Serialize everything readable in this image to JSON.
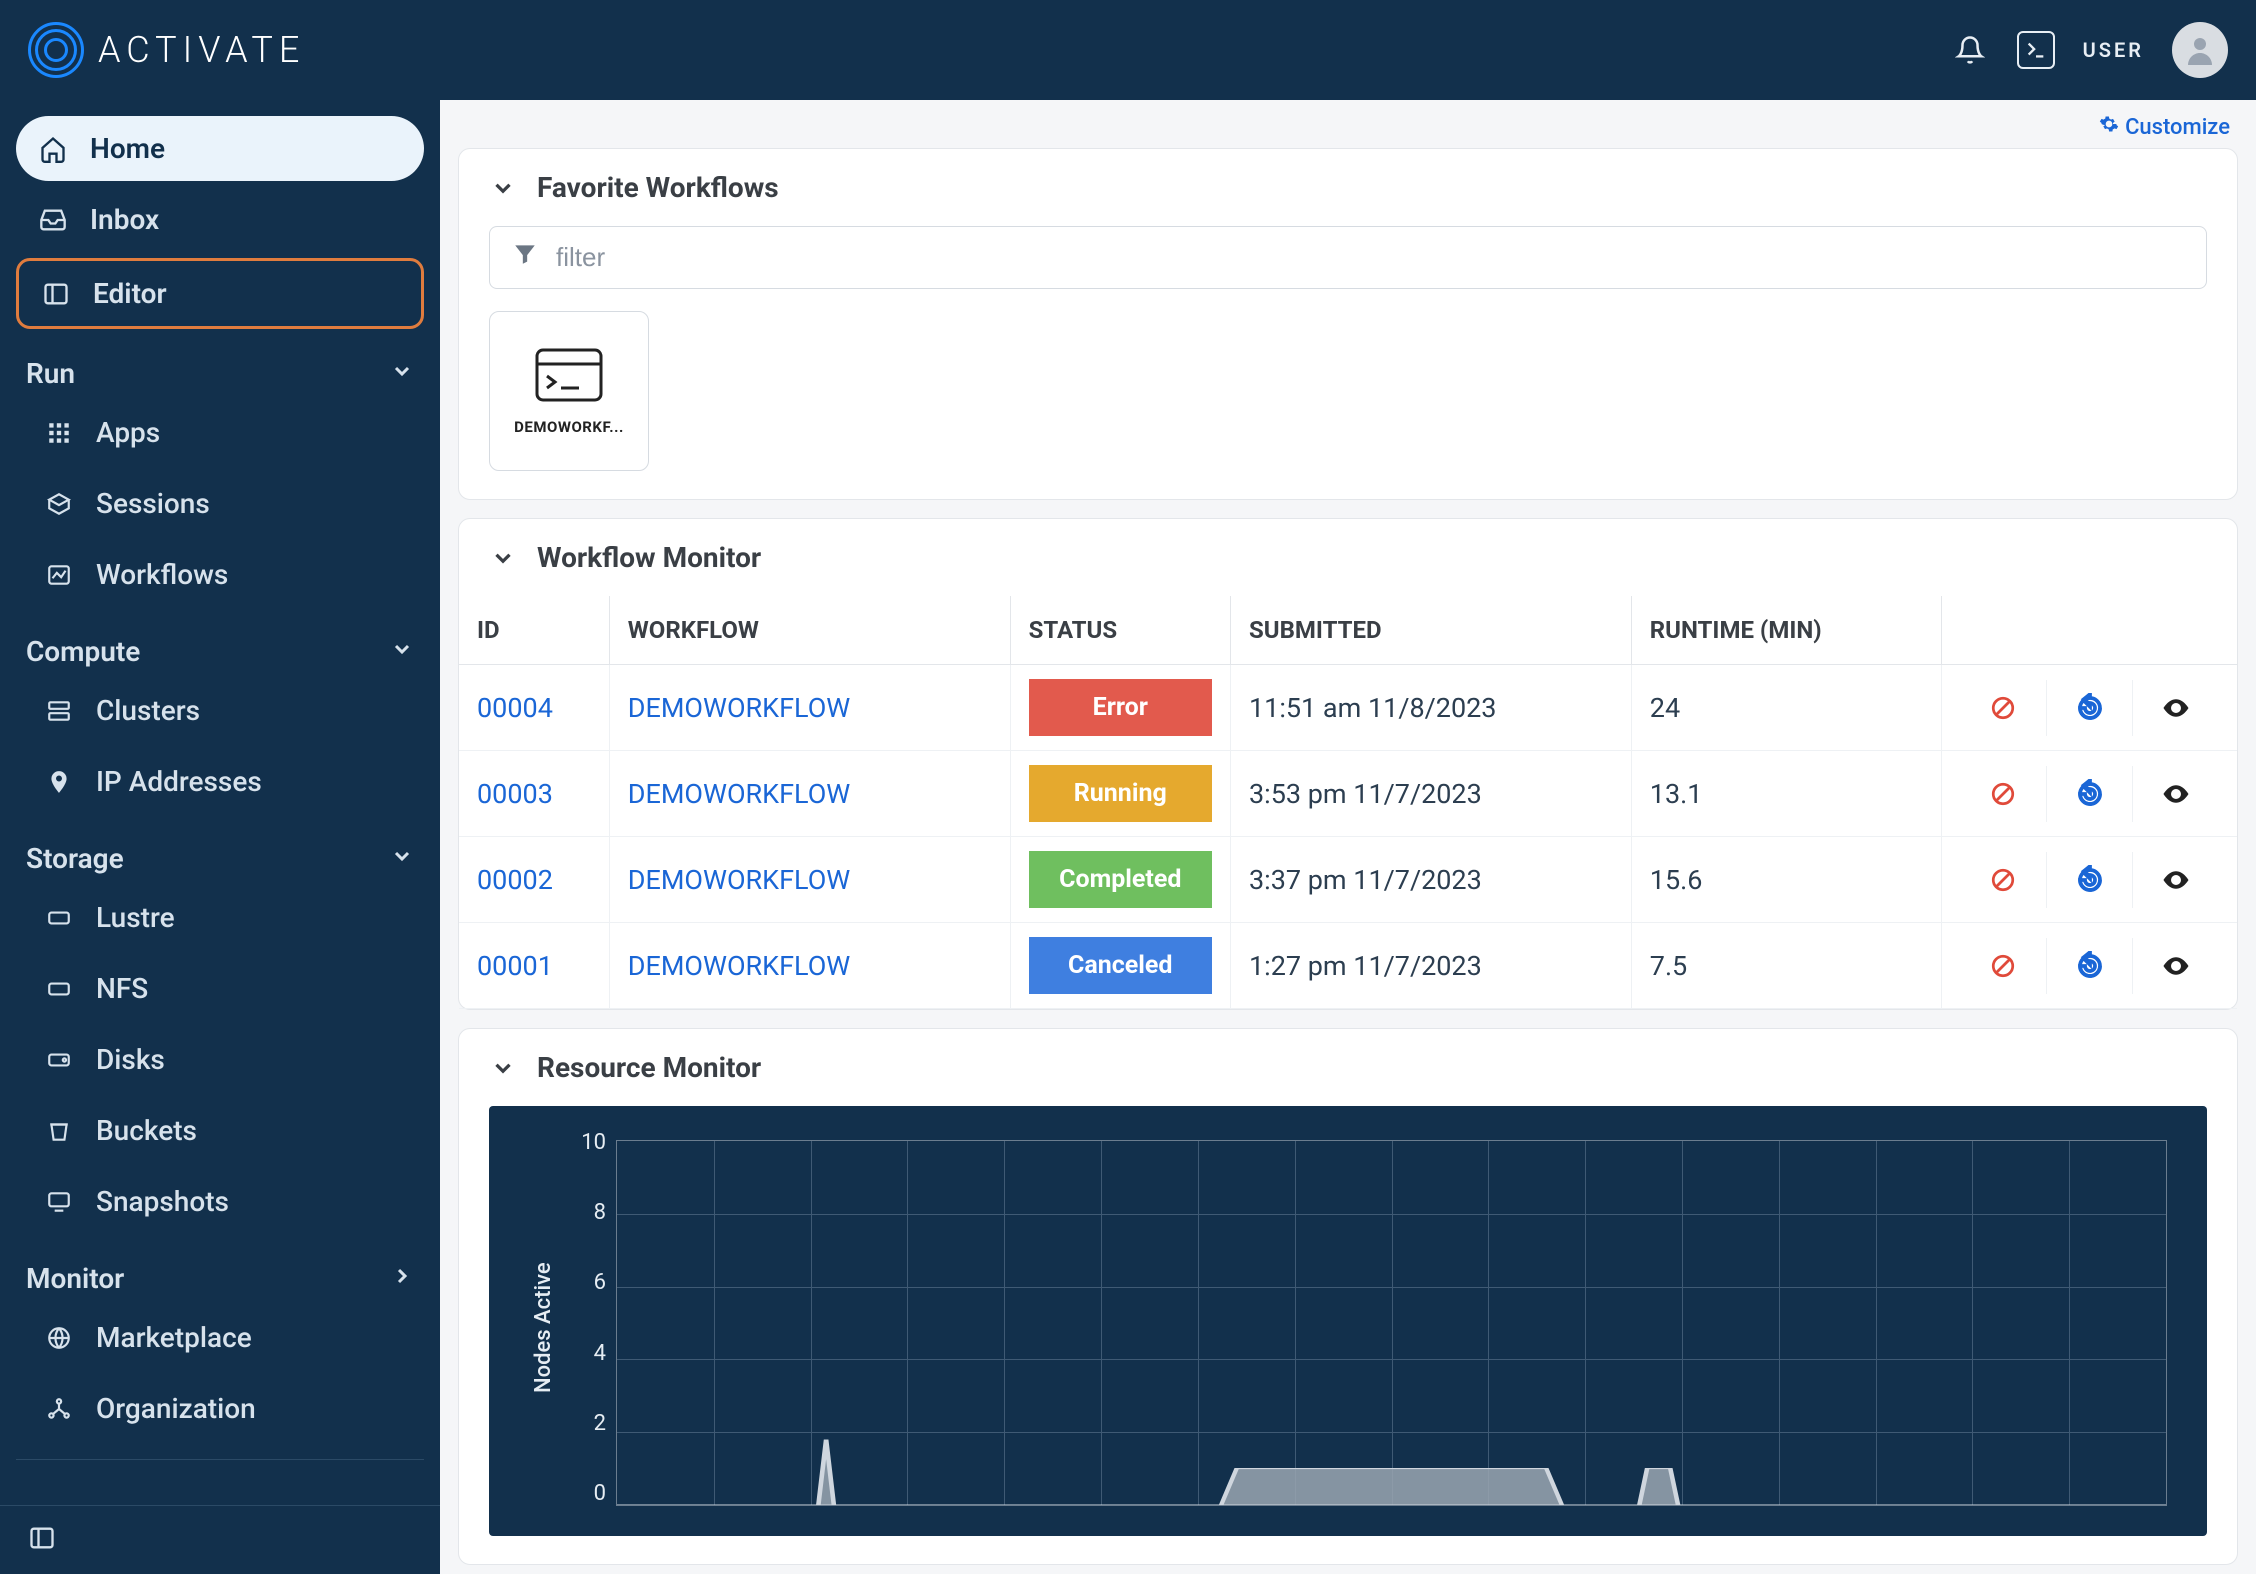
{
  "brand": {
    "name": "ACTIVATE"
  },
  "header": {
    "user_label": "USER"
  },
  "customize_label": "Customize",
  "sidebar": {
    "home": "Home",
    "inbox": "Inbox",
    "editor": "Editor",
    "groups": {
      "run": {
        "label": "Run",
        "items": [
          "Apps",
          "Sessions",
          "Workflows"
        ]
      },
      "compute": {
        "label": "Compute",
        "items": [
          "Clusters",
          "IP Addresses"
        ]
      },
      "storage": {
        "label": "Storage",
        "items": [
          "Lustre",
          "NFS",
          "Disks",
          "Buckets",
          "Snapshots"
        ]
      },
      "monitor": {
        "label": "Monitor"
      }
    },
    "marketplace": "Marketplace",
    "organization": "Organization"
  },
  "panels": {
    "favorites": {
      "title": "Favorite Workflows",
      "filter_placeholder": "filter",
      "cards": [
        {
          "label": "DEMOWORKF..."
        }
      ]
    },
    "workflow_monitor": {
      "title": "Workflow Monitor",
      "columns": [
        "ID",
        "WORKFLOW",
        "STATUS",
        "SUBMITTED",
        "RUNTIME (MIN)",
        ""
      ],
      "rows": [
        {
          "id": "00004",
          "workflow": "DEMOWORKFLOW",
          "status": "Error",
          "status_class": "st-error",
          "submitted": "11:51 am 11/8/2023",
          "runtime": "24"
        },
        {
          "id": "00003",
          "workflow": "DEMOWORKFLOW",
          "status": "Running",
          "status_class": "st-running",
          "submitted": "3:53 pm 11/7/2023",
          "runtime": "13.1"
        },
        {
          "id": "00002",
          "workflow": "DEMOWORKFLOW",
          "status": "Completed",
          "status_class": "st-completed",
          "submitted": "3:37 pm 11/7/2023",
          "runtime": "15.6"
        },
        {
          "id": "00001",
          "workflow": "DEMOWORKFLOW",
          "status": "Canceled",
          "status_class": "st-canceled",
          "submitted": "1:27 pm 11/7/2023",
          "runtime": "7.5"
        }
      ]
    },
    "resource_monitor": {
      "title": "Resource Monitor"
    }
  },
  "chart_data": {
    "type": "area",
    "ylabel": "Nodes Active",
    "ylim": [
      0,
      10
    ],
    "y_ticks": [
      10,
      8,
      6,
      4,
      2,
      0
    ],
    "x_points": 100,
    "series": [
      {
        "name": "nodes",
        "points": [
          {
            "x_pct": 0,
            "y": 0
          },
          {
            "x_pct": 13,
            "y": 0
          },
          {
            "x_pct": 13.5,
            "y": 1.8
          },
          {
            "x_pct": 14,
            "y": 0
          },
          {
            "x_pct": 39,
            "y": 0
          },
          {
            "x_pct": 40,
            "y": 1
          },
          {
            "x_pct": 60,
            "y": 1
          },
          {
            "x_pct": 61,
            "y": 0
          },
          {
            "x_pct": 66,
            "y": 0
          },
          {
            "x_pct": 66.5,
            "y": 1
          },
          {
            "x_pct": 68,
            "y": 1
          },
          {
            "x_pct": 68.5,
            "y": 0
          },
          {
            "x_pct": 100,
            "y": 0
          }
        ]
      }
    ]
  }
}
